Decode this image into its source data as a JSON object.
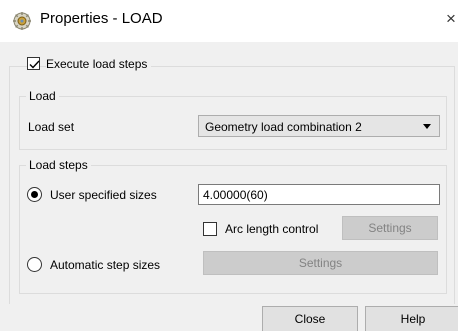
{
  "window": {
    "title": "Properties - LOAD",
    "close_glyph": "×",
    "icon": "gear-app-icon"
  },
  "execute": {
    "label": "Execute load steps",
    "checked": true
  },
  "load_group": {
    "title": "Load",
    "load_set_label": "Load set",
    "load_set_value": "Geometry load combination 2"
  },
  "steps_group": {
    "title": "Load steps",
    "user_sizes": {
      "label": "User specified sizes",
      "selected": true,
      "value": "4.00000(60)"
    },
    "arc_length": {
      "label": "Arc length control",
      "checked": false,
      "settings_label": "Settings"
    },
    "automatic": {
      "label": "Automatic step sizes",
      "selected": false,
      "settings_label": "Settings"
    }
  },
  "footer": {
    "close_label": "Close",
    "help_label": "Help"
  }
}
